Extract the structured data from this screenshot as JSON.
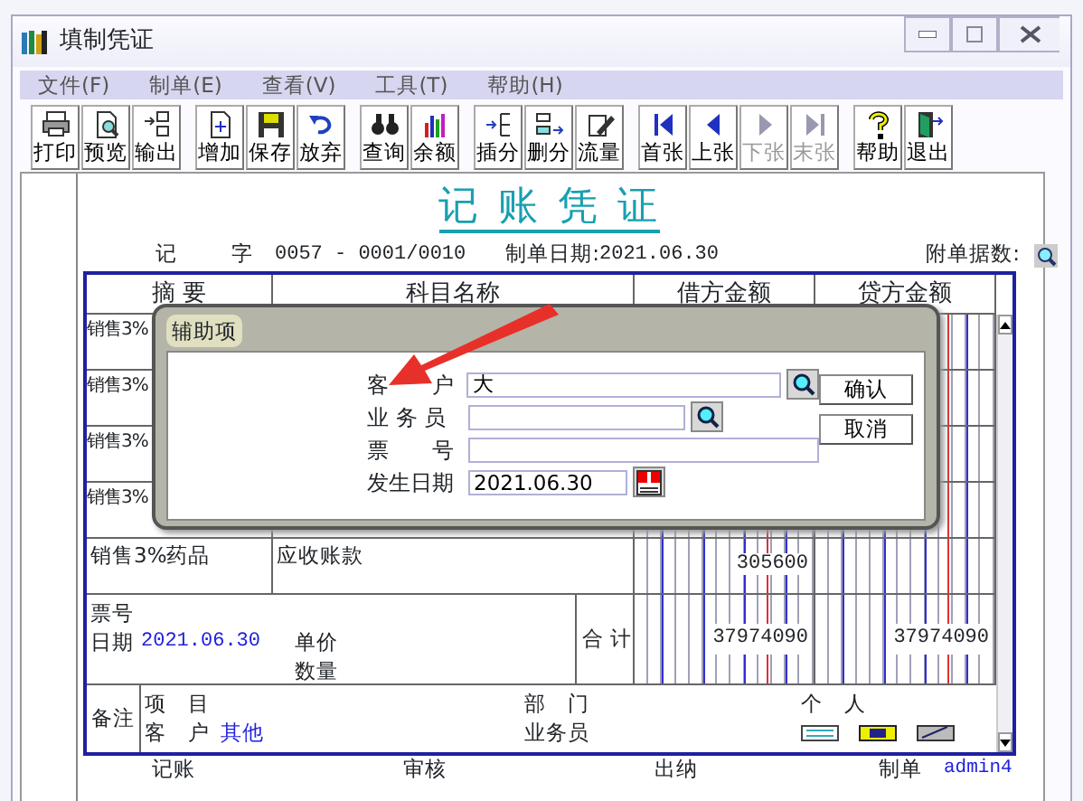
{
  "window": {
    "title": "填制凭证"
  },
  "menu": [
    "文件(F)",
    "制单(E)",
    "查看(V)",
    "工具(T)",
    "帮助(H)"
  ],
  "toolbar": [
    [
      {
        "label": "打印",
        "disabled": false
      },
      {
        "label": "预览",
        "disabled": false
      },
      {
        "label": "输出",
        "disabled": false
      }
    ],
    [
      {
        "label": "增加",
        "disabled": false
      },
      {
        "label": "保存",
        "disabled": false
      },
      {
        "label": "放弃",
        "disabled": false
      }
    ],
    [
      {
        "label": "查询",
        "disabled": false
      },
      {
        "label": "余额",
        "disabled": false
      }
    ],
    [
      {
        "label": "插分",
        "disabled": false
      },
      {
        "label": "删分",
        "disabled": false
      },
      {
        "label": "流量",
        "disabled": false
      }
    ],
    [
      {
        "label": "首张",
        "disabled": false
      },
      {
        "label": "上张",
        "disabled": false
      },
      {
        "label": "下张",
        "disabled": true
      },
      {
        "label": "末张",
        "disabled": true
      }
    ],
    [
      {
        "label": "帮助",
        "disabled": false
      },
      {
        "label": "退出",
        "disabled": false
      }
    ]
  ],
  "voucher": {
    "title": "记 账 凭 证",
    "type": "记",
    "type_suffix": "字",
    "number": "0057 - 0001/0010",
    "date_label": "制单日期:",
    "date": "2021.06.30",
    "attachments_label": "附单据数:"
  },
  "table": {
    "columns": [
      "摘 要",
      "科目名称",
      "借方金额",
      "贷方金额"
    ],
    "rows": [
      {
        "summary": "销售3%"
      },
      {
        "summary": "销售3%"
      },
      {
        "summary": "销售3%"
      },
      {
        "summary": "销售3%"
      },
      {
        "summary": "销售3%药品",
        "account": "应收账款",
        "debit": "305600"
      }
    ]
  },
  "totals": {
    "invoice_label": "票号",
    "date_label": "日期",
    "date": "2021.06.30",
    "price_label": "单价",
    "qty_label": "数量",
    "total_label": "合 计",
    "debit": "37974090",
    "credit": "37974090"
  },
  "remarks": {
    "label": "备注",
    "project_label": "项　目",
    "customer_label": "客　户",
    "customer": "其他",
    "dept_label": "部　门",
    "salesperson_label": "业务员",
    "person_label": "个　人"
  },
  "signatures": [
    {
      "label": "记账"
    },
    {
      "label": "审核"
    },
    {
      "label": "出纳"
    },
    {
      "label": "制单",
      "value": "admin4"
    }
  ],
  "dialog": {
    "title": "辅助项",
    "fields": [
      {
        "label": "客　　户",
        "value": "大",
        "kind": "lookup"
      },
      {
        "label": "业 务 员",
        "kind": "lookup"
      },
      {
        "label": "票　　号",
        "kind": "text"
      },
      {
        "label": "发生日期",
        "value": "2021.06.30",
        "kind": "date"
      }
    ],
    "buttons": [
      "确认",
      "取消"
    ]
  }
}
